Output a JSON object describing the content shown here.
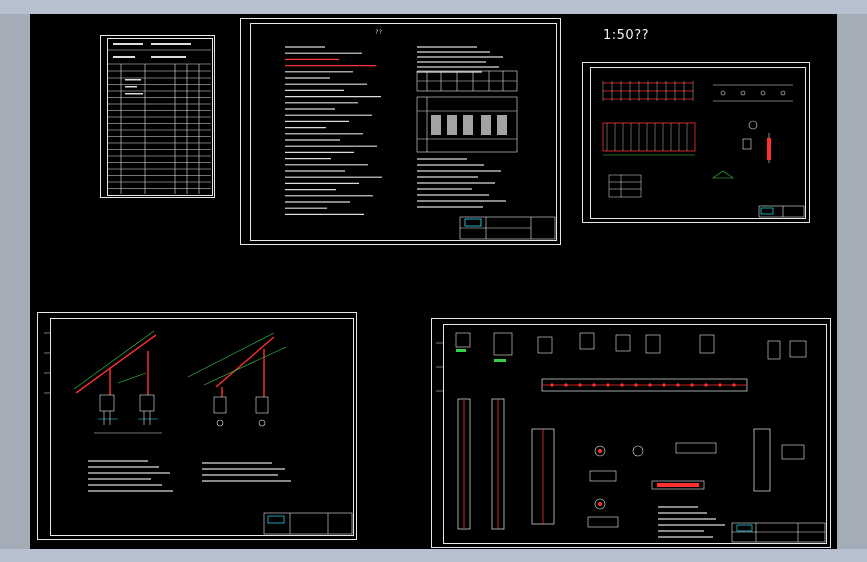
{
  "viewport": {
    "background": "#000000",
    "frame_color": "#b7c0ce",
    "line_color": "#e8e8e8",
    "accent_red": "#ff3030",
    "accent_green": "#36d04a",
    "accent_cyan": "#30e0ff"
  },
  "sheets": [
    {
      "name": "index-sheet",
      "title_text": ""
    },
    {
      "name": "design-notes-sheet",
      "title_text": "??"
    },
    {
      "name": "layout-plan-sheet",
      "scale_text": "1:50??"
    },
    {
      "name": "section-sheet",
      "title_text": ""
    },
    {
      "name": "detail-sheet",
      "title_text": ""
    }
  ]
}
